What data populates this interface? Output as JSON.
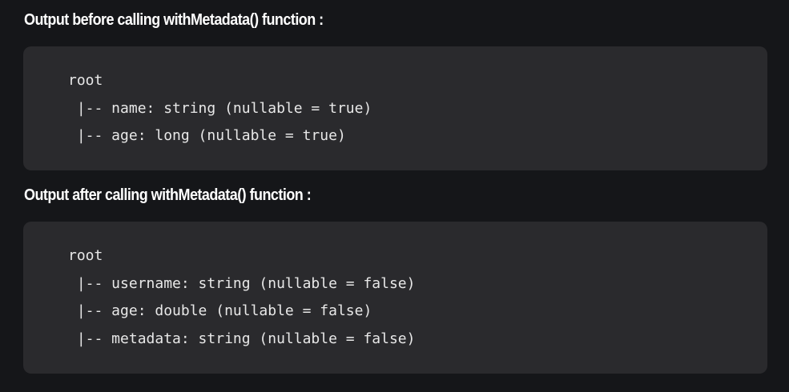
{
  "sections": [
    {
      "heading": "Output before calling withMetadata() function :",
      "code_lines": [
        "root",
        " |-- name: string (nullable = true)",
        " |-- age: long (nullable = true)"
      ]
    },
    {
      "heading": "Output after calling withMetadata() function :",
      "code_lines": [
        "root",
        " |-- username: string (nullable = false)",
        " |-- age: double (nullable = false)",
        " |-- metadata: string (nullable = false)"
      ]
    }
  ]
}
